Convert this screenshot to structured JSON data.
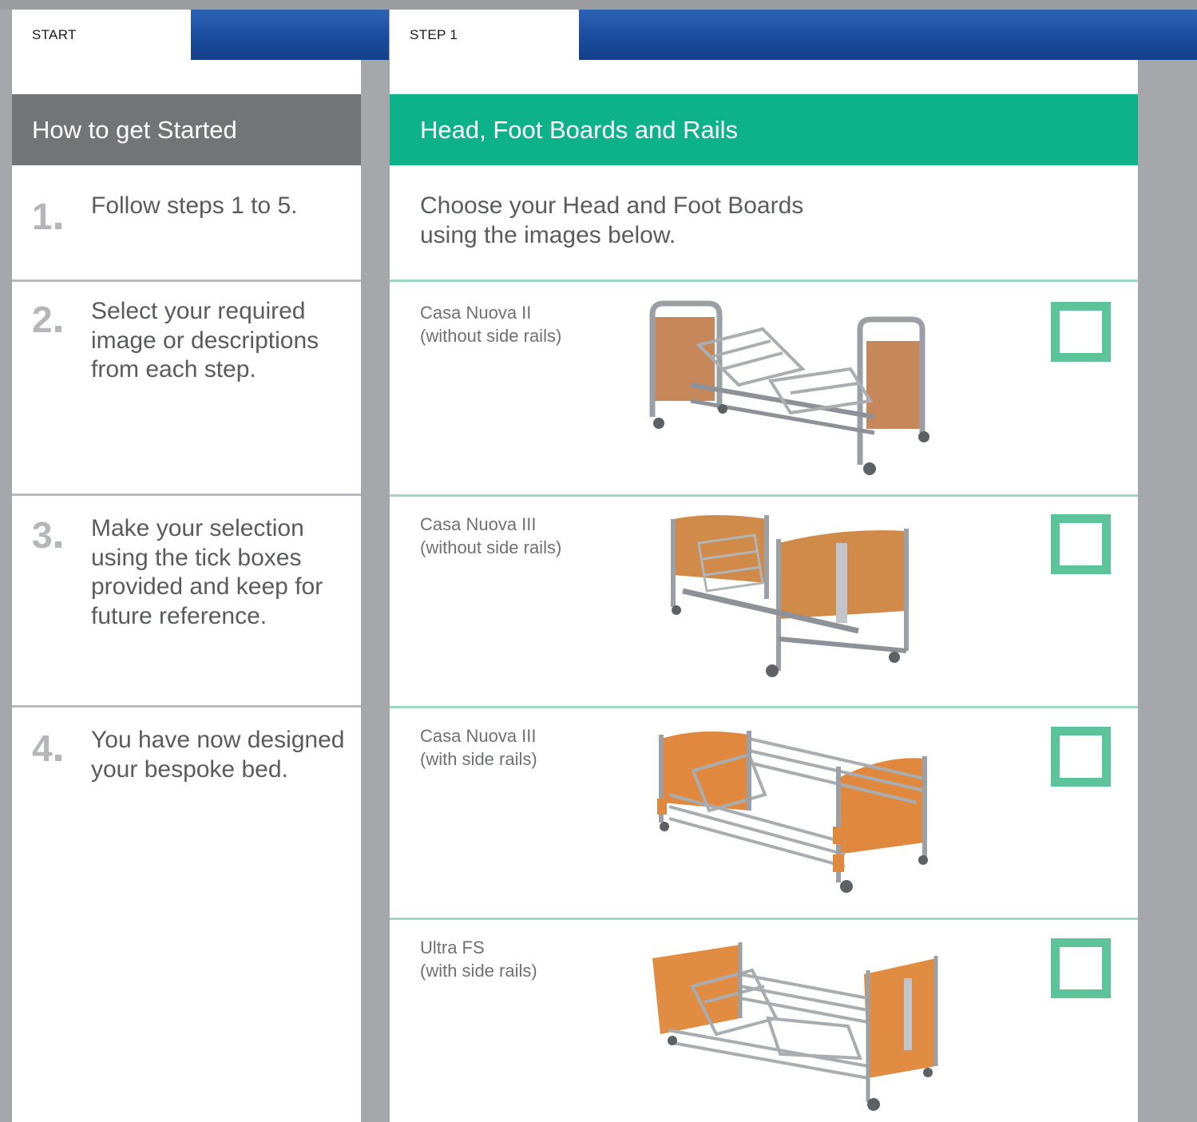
{
  "start": {
    "tab_label": "START",
    "heading": "How to get Started",
    "steps": [
      {
        "num": "1",
        "text": "Follow steps 1 to 5."
      },
      {
        "num": "2",
        "text": "Select your required image or descriptions from each step."
      },
      {
        "num": "3",
        "text": "Make your selection using the tick boxes provided and keep for future reference."
      },
      {
        "num": "4",
        "text": "You have now designed your bespoke bed."
      }
    ]
  },
  "step1": {
    "tab_label": "STEP 1",
    "heading": "Head, Foot Boards and Rails",
    "intro_line1": "Choose your Head and Foot Boards",
    "intro_line2": "using the images below.",
    "products": [
      {
        "name": "Casa Nuova II",
        "note": "(without side rails)",
        "checked": false
      },
      {
        "name": "Casa Nuova III",
        "note": "(without side rails)",
        "checked": false
      },
      {
        "name": "Casa Nuova III",
        "note": "(with side rails)",
        "checked": false
      },
      {
        "name": "Ultra FS",
        "note": "(with side rails)",
        "checked": false
      }
    ]
  },
  "colors": {
    "start_band": "#737478",
    "step1_band": "#0eb28a",
    "tab_blue": "#1b4c9e",
    "tick_border": "#5cc39a"
  }
}
